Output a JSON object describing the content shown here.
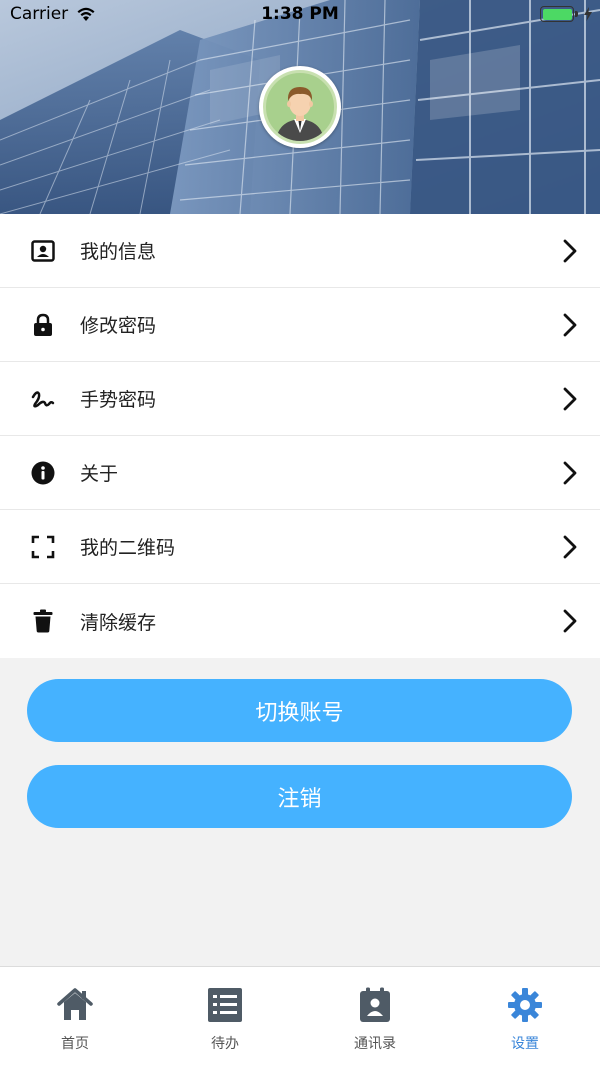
{
  "status_bar": {
    "carrier": "Carrier",
    "time": "1:38 PM"
  },
  "profile": {
    "avatar_icon": "user-avatar"
  },
  "menu": {
    "items": [
      {
        "label": "我的信息",
        "icon": "contact-card-icon"
      },
      {
        "label": "修改密码",
        "icon": "lock-icon"
      },
      {
        "label": "手势密码",
        "icon": "gesture-icon"
      },
      {
        "label": "关于",
        "icon": "info-icon"
      },
      {
        "label": "我的二维码",
        "icon": "qr-scan-icon"
      },
      {
        "label": "清除缓存",
        "icon": "trash-icon"
      }
    ]
  },
  "actions": {
    "switch_account": "切换账号",
    "logout": "注销"
  },
  "tabbar": {
    "tabs": [
      {
        "label": "首页",
        "icon": "home-icon"
      },
      {
        "label": "待办",
        "icon": "list-icon"
      },
      {
        "label": "通讯录",
        "icon": "contacts-icon"
      },
      {
        "label": "设置",
        "icon": "gear-icon"
      }
    ],
    "active_index": 3
  },
  "colors": {
    "accent": "#45b2ff",
    "active_tab": "#3a86d9",
    "battery": "#4cd964"
  }
}
